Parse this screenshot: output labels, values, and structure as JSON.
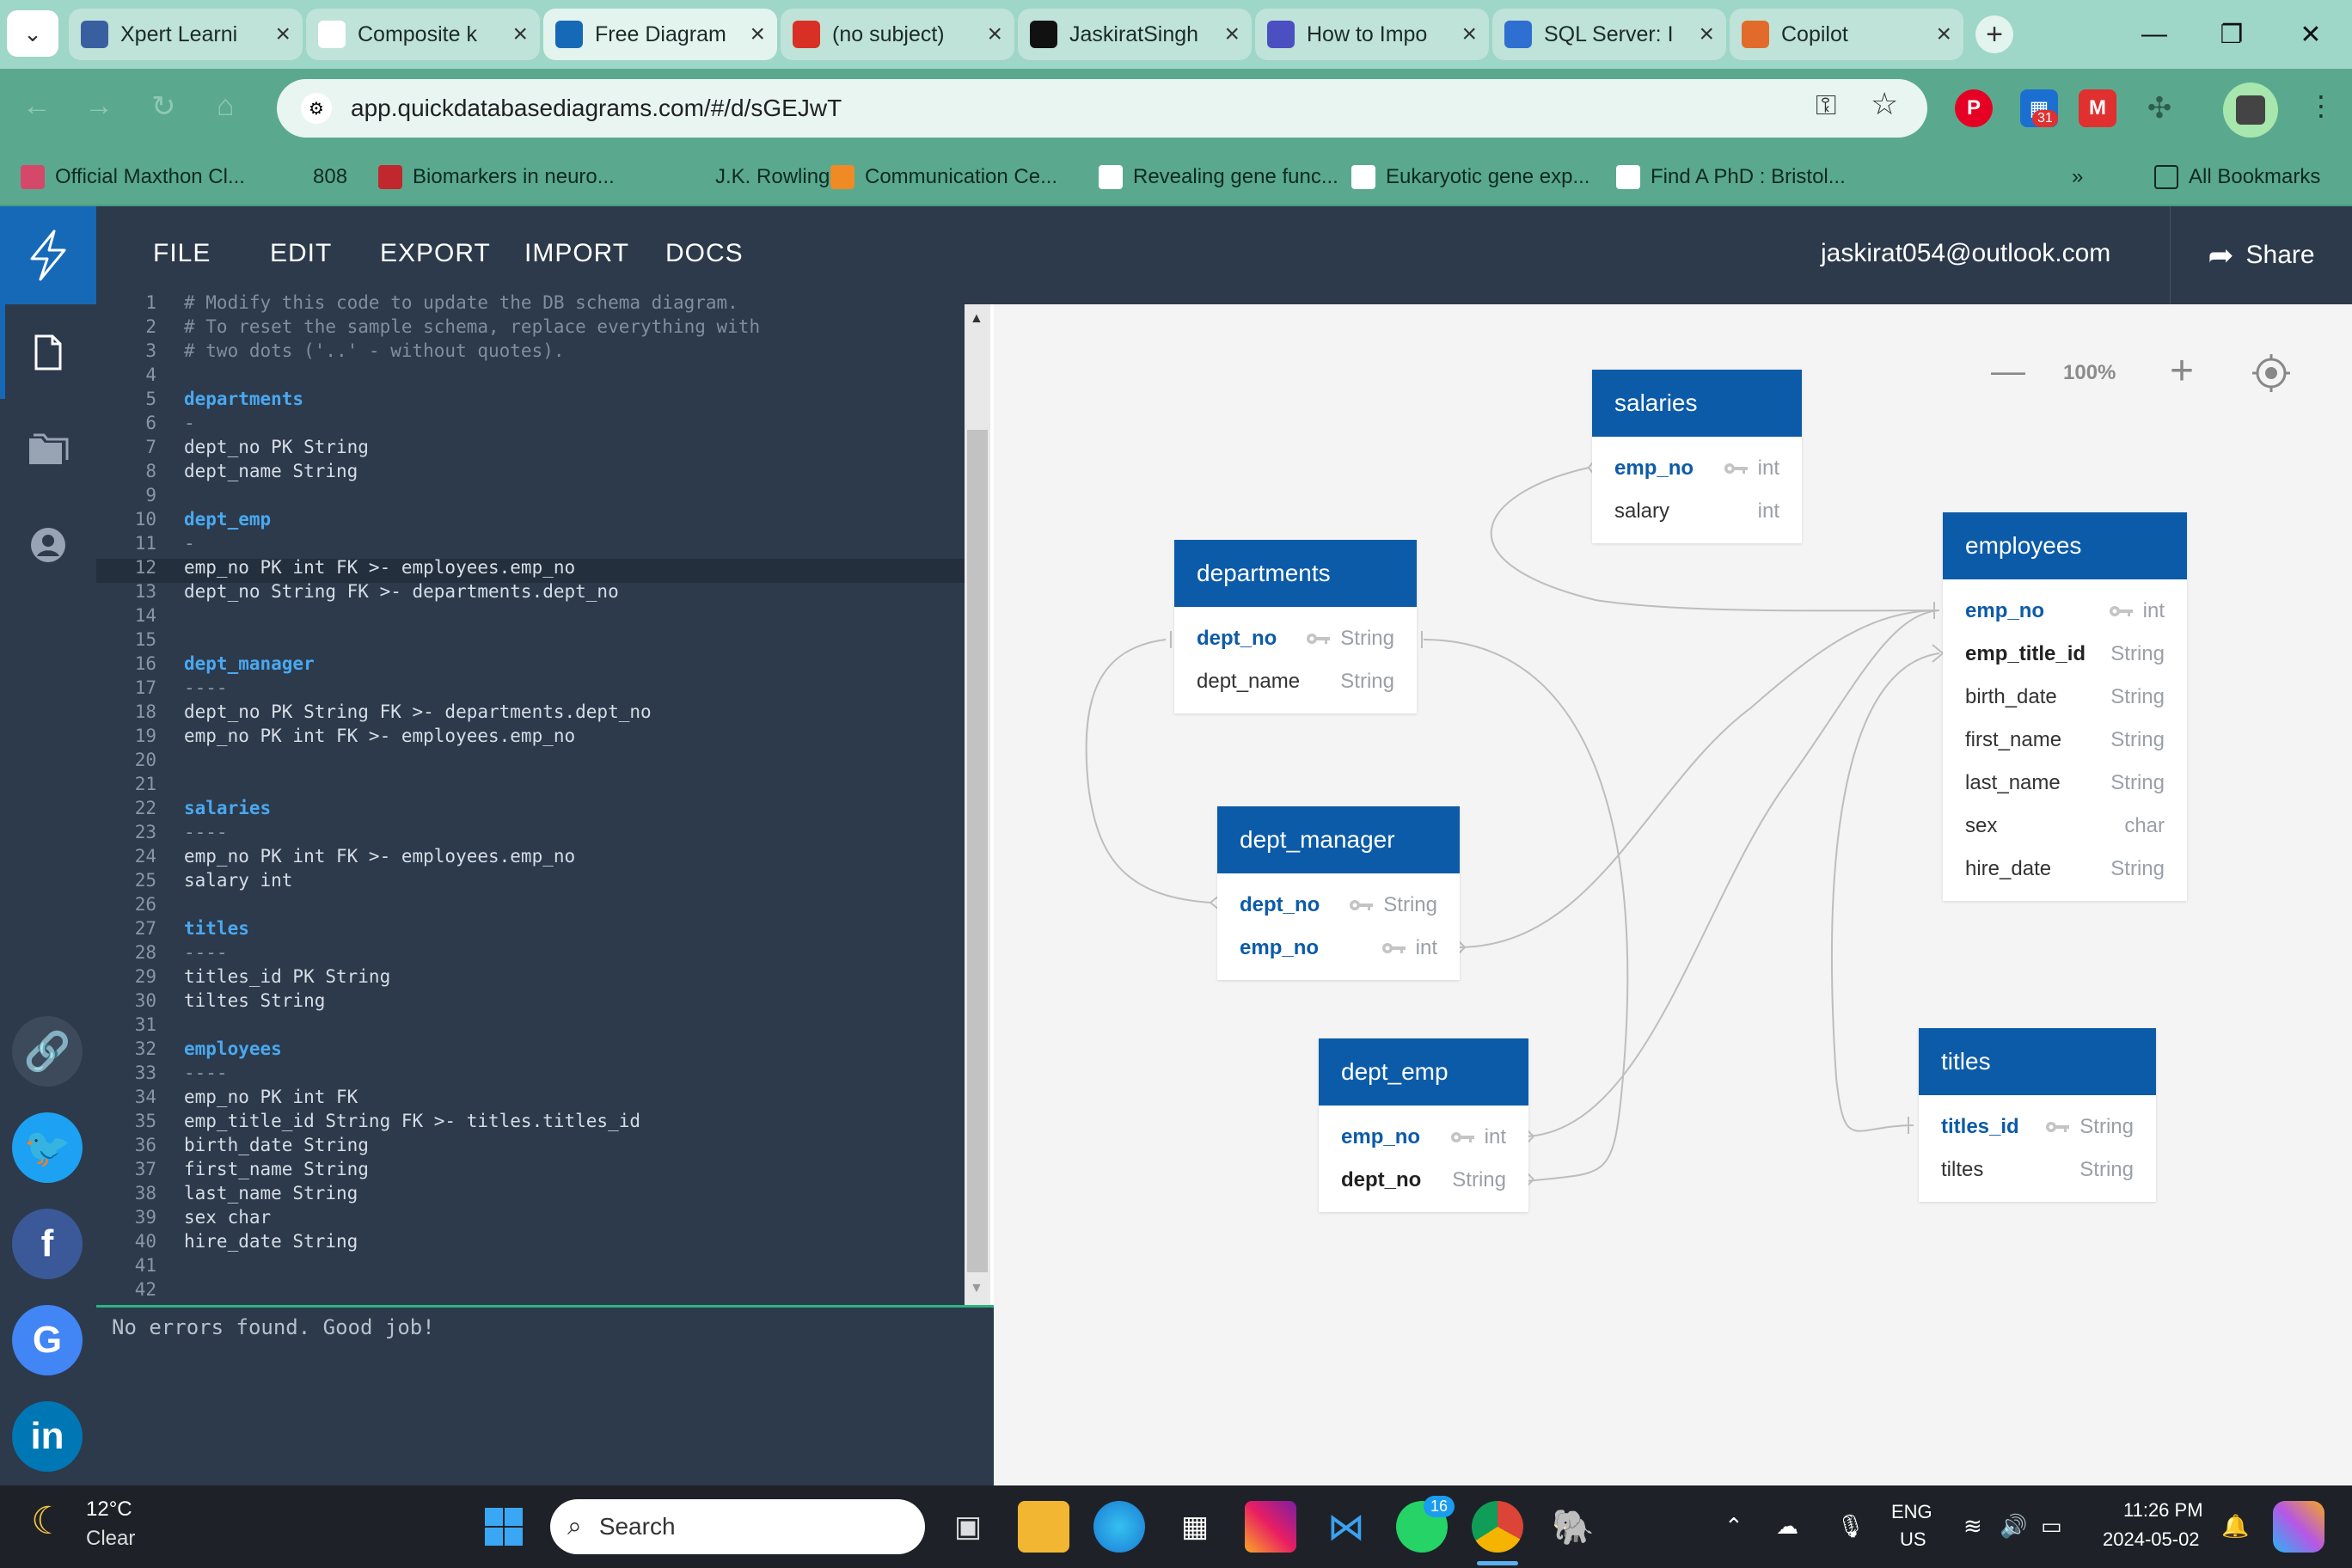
{
  "browser": {
    "tabs": [
      {
        "title": "Xpert Learni",
        "icon": "xpert-icon",
        "color": "#3a5fa0"
      },
      {
        "title": "Composite k",
        "icon": "wikipedia-icon",
        "color": "#ffffff"
      },
      {
        "title": "Free Diagram",
        "icon": "qdd-icon",
        "color": "#1669b7",
        "active": true
      },
      {
        "title": "(no subject)",
        "icon": "gmail-icon",
        "color": "#d93025"
      },
      {
        "title": "JaskiratSingh",
        "icon": "github-icon",
        "color": "#111111"
      },
      {
        "title": "How to Impo",
        "icon": "article-icon",
        "color": "#4b4fc1"
      },
      {
        "title": "SQL Server: I",
        "icon": "sqlserver-icon",
        "color": "#2f6fd1"
      },
      {
        "title": "Copilot",
        "icon": "copilot-icon",
        "color": "#e26b2b"
      }
    ],
    "url": "app.quickdatabasediagrams.com/#/d/sGEJwT",
    "bookmarks": [
      {
        "label": "Official Maxthon Cl...",
        "color": "#d5486a"
      },
      {
        "label": "808",
        "color": "#5aa98f"
      },
      {
        "label": "Biomarkers in neuro...",
        "color": "#c0282d"
      },
      {
        "label": "J.K. Rowling -",
        "color": "#5aa98f"
      },
      {
        "label": "Communication Ce...",
        "color": "#f08a24"
      },
      {
        "label": "Revealing gene func...",
        "color": "#ffffff"
      },
      {
        "label": "Eukaryotic gene exp...",
        "color": "#ffffff"
      },
      {
        "label": "Find A PhD : Bristol...",
        "color": "#ffffff"
      }
    ],
    "more_bookmarks": "»",
    "all_bookmarks": "All Bookmarks",
    "calendar_badge": "31"
  },
  "app": {
    "menu": [
      "FILE",
      "EDIT",
      "EXPORT",
      "IMPORT",
      "DOCS"
    ],
    "user_email": "jaskirat054@outlook.com",
    "share_label": "Share",
    "zoom": "100%",
    "status": "No errors found. Good job!"
  },
  "editor": {
    "lines": [
      {
        "n": "1",
        "t": "# Modify this code to update the DB schema diagram.",
        "k": "comment"
      },
      {
        "n": "2",
        "t": "# To reset the sample schema, replace everything with",
        "k": "comment"
      },
      {
        "n": "3",
        "t": "# two dots ('..' - without quotes).",
        "k": "comment"
      },
      {
        "n": "4",
        "t": "",
        "k": ""
      },
      {
        "n": "5",
        "t": "departments",
        "k": "table"
      },
      {
        "n": "6",
        "t": "-",
        "k": "dim"
      },
      {
        "n": "7",
        "t": "dept_no PK String",
        "k": "field"
      },
      {
        "n": "8",
        "t": "dept_name String",
        "k": "field"
      },
      {
        "n": "9",
        "t": "",
        "k": ""
      },
      {
        "n": "10",
        "t": "dept_emp",
        "k": "table"
      },
      {
        "n": "11",
        "t": "-",
        "k": "dim"
      },
      {
        "n": "12",
        "t": "emp_no PK int FK >- employees.emp_no",
        "k": "field"
      },
      {
        "n": "13",
        "t": "dept_no String FK >- departments.dept_no",
        "k": "field"
      },
      {
        "n": "14",
        "t": "",
        "k": ""
      },
      {
        "n": "15",
        "t": "",
        "k": ""
      },
      {
        "n": "16",
        "t": "dept_manager",
        "k": "table"
      },
      {
        "n": "17",
        "t": "----",
        "k": "dim"
      },
      {
        "n": "18",
        "t": "dept_no PK String FK >- departments.dept_no",
        "k": "field"
      },
      {
        "n": "19",
        "t": "emp_no PK int FK >- employees.emp_no",
        "k": "field"
      },
      {
        "n": "20",
        "t": "",
        "k": ""
      },
      {
        "n": "21",
        "t": "",
        "k": ""
      },
      {
        "n": "22",
        "t": "salaries",
        "k": "table"
      },
      {
        "n": "23",
        "t": "----",
        "k": "dim"
      },
      {
        "n": "24",
        "t": "emp_no PK int FK >- employees.emp_no",
        "k": "field"
      },
      {
        "n": "25",
        "t": "salary int",
        "k": "field"
      },
      {
        "n": "26",
        "t": "",
        "k": ""
      },
      {
        "n": "27",
        "t": "titles",
        "k": "table"
      },
      {
        "n": "28",
        "t": "----",
        "k": "dim"
      },
      {
        "n": "29",
        "t": "titles_id PK String",
        "k": "field"
      },
      {
        "n": "30",
        "t": "tiltes String",
        "k": "field"
      },
      {
        "n": "31",
        "t": "",
        "k": ""
      },
      {
        "n": "32",
        "t": "employees",
        "k": "table"
      },
      {
        "n": "33",
        "t": "----",
        "k": "dim"
      },
      {
        "n": "34",
        "t": "emp_no PK int FK",
        "k": "field"
      },
      {
        "n": "35",
        "t": "emp_title_id String FK >- titles.titles_id",
        "k": "field"
      },
      {
        "n": "36",
        "t": "birth_date String",
        "k": "field"
      },
      {
        "n": "37",
        "t": "first_name String",
        "k": "field"
      },
      {
        "n": "38",
        "t": "last_name String",
        "k": "field"
      },
      {
        "n": "39",
        "t": "sex char",
        "k": "field"
      },
      {
        "n": "40",
        "t": "hire_date String",
        "k": "field"
      },
      {
        "n": "41",
        "t": "",
        "k": ""
      },
      {
        "n": "42",
        "t": "",
        "k": ""
      }
    ]
  },
  "diagram": {
    "salaries": {
      "title": "salaries",
      "fields": [
        {
          "name": "emp_no",
          "type": "int",
          "key": true
        },
        {
          "name": "salary",
          "type": "int"
        }
      ]
    },
    "departments": {
      "title": "departments",
      "fields": [
        {
          "name": "dept_no",
          "type": "String",
          "key": true
        },
        {
          "name": "dept_name",
          "type": "String"
        }
      ]
    },
    "employees": {
      "title": "employees",
      "fields": [
        {
          "name": "emp_no",
          "type": "int",
          "key": true
        },
        {
          "name": "emp_title_id",
          "type": "String",
          "fk": true
        },
        {
          "name": "birth_date",
          "type": "String"
        },
        {
          "name": "first_name",
          "type": "String"
        },
        {
          "name": "last_name",
          "type": "String"
        },
        {
          "name": "sex",
          "type": "char"
        },
        {
          "name": "hire_date",
          "type": "String"
        }
      ]
    },
    "dept_manager": {
      "title": "dept_manager",
      "fields": [
        {
          "name": "dept_no",
          "type": "String",
          "key": true
        },
        {
          "name": "emp_no",
          "type": "int",
          "key": true
        }
      ]
    },
    "dept_emp": {
      "title": "dept_emp",
      "fields": [
        {
          "name": "emp_no",
          "type": "int",
          "key": true
        },
        {
          "name": "dept_no",
          "type": "String",
          "fk": true
        }
      ]
    },
    "titles": {
      "title": "titles",
      "fields": [
        {
          "name": "titles_id",
          "type": "String",
          "key": true
        },
        {
          "name": "tiltes",
          "type": "String"
        }
      ]
    }
  },
  "taskbar": {
    "weather_temp": "12°C",
    "weather_desc": "Clear",
    "search_placeholder": "Search",
    "whatsapp_badge": "16",
    "lang_top": "ENG",
    "lang_bottom": "US",
    "time": "11:26 PM",
    "date": "2024-05-02"
  }
}
